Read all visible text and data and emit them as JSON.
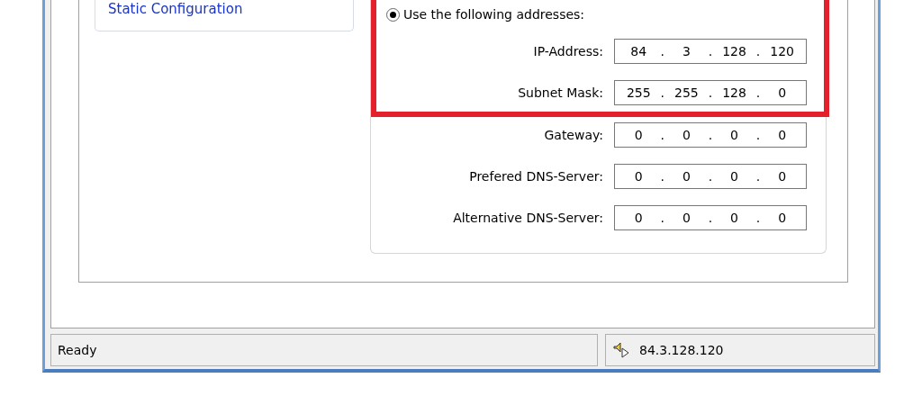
{
  "sidebar": {
    "items": [
      {
        "label": "Static Configuration",
        "selected": false
      }
    ]
  },
  "address_group": {
    "radio": {
      "label": "Use the following addresses:",
      "selected": true
    },
    "highlighted_fields": [
      {
        "label": "IP-Address:",
        "octets": [
          "84",
          "3",
          "128",
          "120"
        ]
      },
      {
        "label": "Subnet Mask:",
        "octets": [
          "255",
          "255",
          "128",
          "0"
        ]
      }
    ],
    "fields": [
      {
        "label": "Gateway:",
        "octets": [
          "0",
          "0",
          "0",
          "0"
        ]
      },
      {
        "label": "Prefered DNS-Server:",
        "octets": [
          "0",
          "0",
          "0",
          "0"
        ]
      },
      {
        "label": "Alternative DNS-Server:",
        "octets": [
          "0",
          "0",
          "0",
          "0"
        ]
      }
    ],
    "separator": "."
  },
  "status_bar": {
    "status": "Ready",
    "address": "84.3.128.120"
  }
}
